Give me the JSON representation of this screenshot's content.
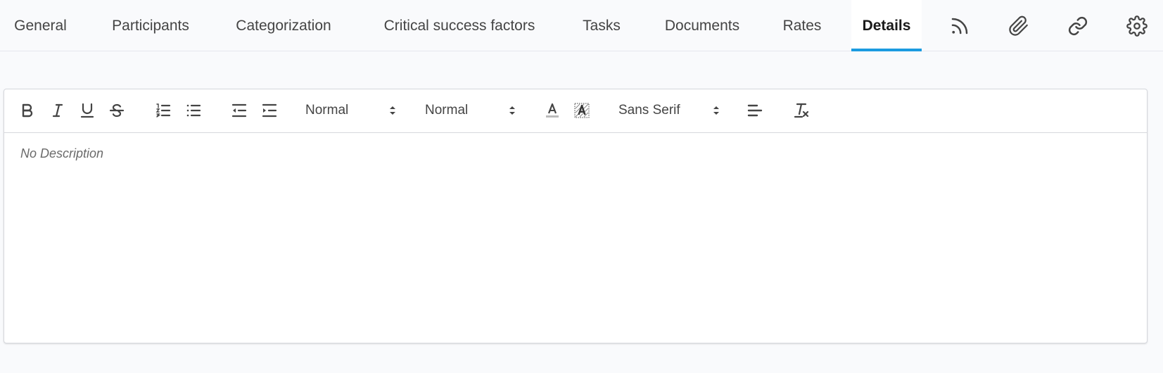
{
  "tabs": {
    "general": "General",
    "participants": "Participants",
    "categorization": "Categorization",
    "critical_success_factors": "Critical success factors",
    "tasks": "Tasks",
    "documents": "Documents",
    "rates": "Rates",
    "details": "Details",
    "active": "Details"
  },
  "tab_icons": [
    "rss-icon",
    "paperclip-icon",
    "link-icon",
    "gear-icon"
  ],
  "toolbar": {
    "buttons": [
      "bold-icon",
      "italic-icon",
      "underline-icon",
      "strikethrough-icon",
      "ordered-list-icon",
      "bullet-list-icon",
      "outdent-icon",
      "indent-icon",
      "font-color-icon",
      "background-color-icon",
      "align-left-icon",
      "clear-format-icon"
    ],
    "heading_select": "Normal",
    "size_select": "Normal",
    "font_select": "Sans Serif"
  },
  "editor": {
    "placeholder": "No Description"
  },
  "colors": {
    "accent": "#1b9be0",
    "background": "#f9fafc",
    "icon": "#444444"
  }
}
